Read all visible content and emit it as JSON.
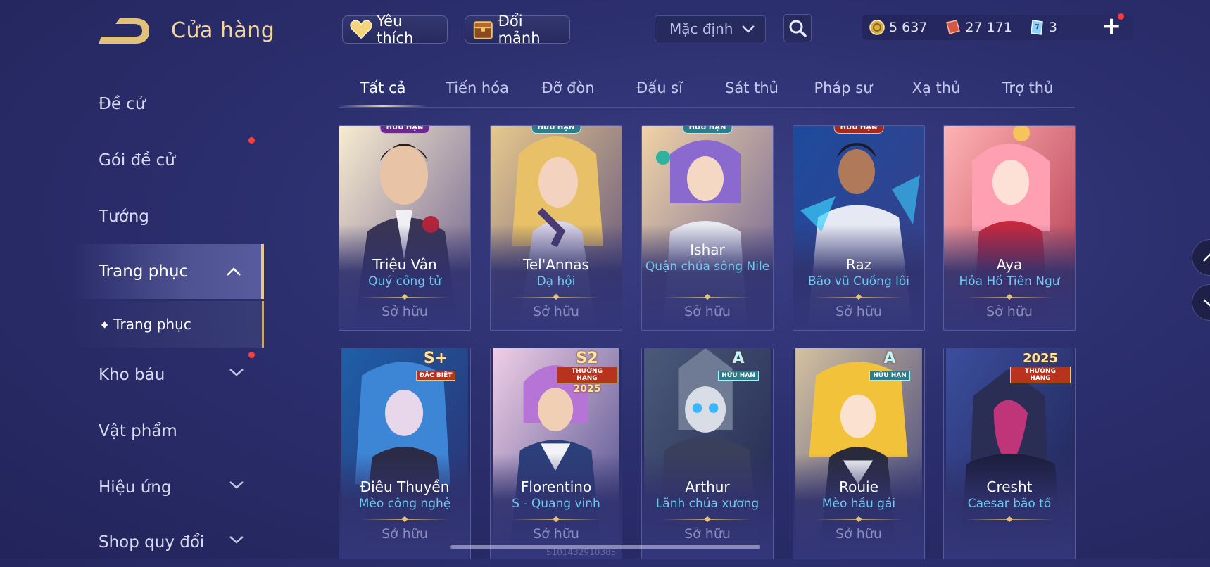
{
  "header": {
    "title": "Cửa hàng",
    "favorite_label": "Yêu thích",
    "exchange_label": "Đổi mảnh",
    "sort_value": "Mặc định",
    "currencies": [
      {
        "name": "gold",
        "icon": "gold-coin-icon",
        "value": "5 637"
      },
      {
        "name": "voucher",
        "icon": "voucher-icon",
        "value": "27 171"
      },
      {
        "name": "crystal",
        "icon": "crystal-icon",
        "value": "3"
      }
    ]
  },
  "sidebar": {
    "items": [
      {
        "label": "Đề cử"
      },
      {
        "label": "Gói đề cử"
      },
      {
        "label": "Tướng"
      },
      {
        "label": "Trang phục"
      },
      {
        "label": "Kho báu"
      },
      {
        "label": "Vật phẩm"
      },
      {
        "label": "Hiệu ứng"
      },
      {
        "label": "Shop quy đổi"
      }
    ],
    "sub_item": "Trang phục"
  },
  "tabs": [
    "Tất cả",
    "Tiến hóa",
    "Đỡ đòn",
    "Đấu sĩ",
    "Sát thủ",
    "Pháp sư",
    "Xạ thủ",
    "Trợ thủ"
  ],
  "active_tab": "Tất cả",
  "cards": [
    {
      "hero": "Triệu Vân",
      "skin": "Quý công tử",
      "status": "Sở hữu",
      "badge": "HỮU HẠN"
    },
    {
      "hero": "Tel'Annas",
      "skin": "Dạ hội",
      "status": "Sở hữu",
      "badge": "HỮU HẠN"
    },
    {
      "hero": "Ishar",
      "skin": "Quận chúa sông Nile",
      "status": "Sở hữu",
      "badge": "HỮU HẠN"
    },
    {
      "hero": "Raz",
      "skin": "Bão vũ Cuồng lôi",
      "status": "Sở hữu",
      "badge": "HỮU HẠN"
    },
    {
      "hero": "Aya",
      "skin": "Hỏa Hồ Tiên Ngư",
      "status": "Sở hữu",
      "badge": ""
    },
    {
      "hero": "Điêu Thuyền",
      "skin": "Mèo công nghệ",
      "status": "Sở hữu",
      "badge_big": "S+",
      "badge_small": "ĐẶC BIỆT"
    },
    {
      "hero": "Florentino",
      "skin": "S - Quang vinh",
      "status": "Sở hữu",
      "badge_big": "S2",
      "badge_small": "THƯỜNG HẠNG",
      "badge_year": "2025"
    },
    {
      "hero": "Arthur",
      "skin": "Lãnh chúa xương",
      "status": "Sở hữu",
      "badge_big": "A",
      "badge_small": "HỮU HẠN"
    },
    {
      "hero": "Rouie",
      "skin": "Mèo hầu gái",
      "status": "Sở hữu",
      "badge_big": "A",
      "badge_small": "HỮU HẠN"
    },
    {
      "hero": "Cresht",
      "skin": "Caesar bão tố",
      "status": "",
      "badge_big": "2025",
      "badge_small": "THƯỜNG HẠNG"
    }
  ],
  "footer": {
    "uid": "5101432910385"
  },
  "colors": {
    "accent_gold": "#f3d79a",
    "skin_name": "#6fc8f0",
    "notification": "#ff3b3b"
  }
}
